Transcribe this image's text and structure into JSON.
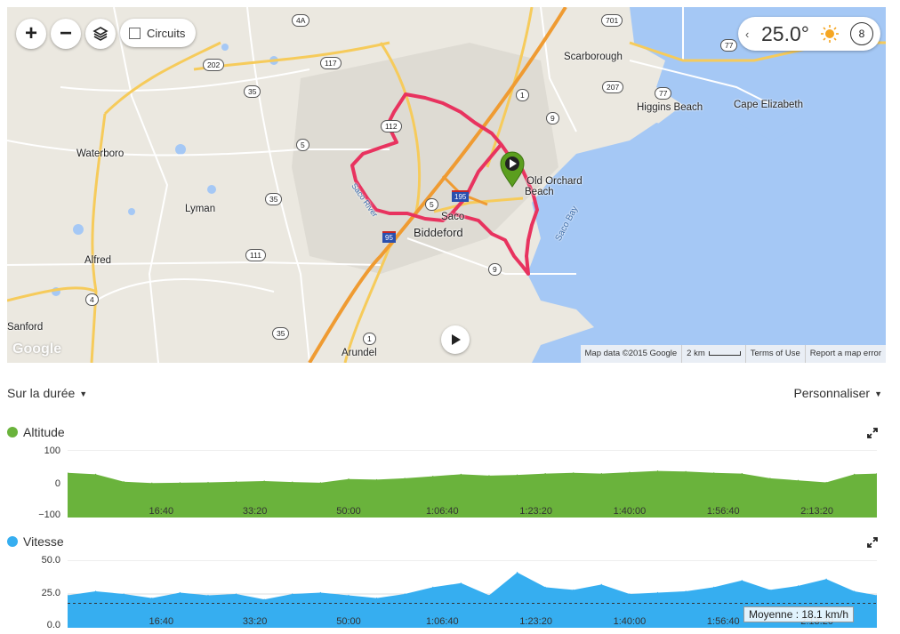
{
  "map": {
    "controls": {
      "zoom_in": "+",
      "zoom_out": "−",
      "circuits_label": "Circuits"
    },
    "weather": {
      "temperature": "25.0°",
      "wind": "8",
      "icon": "sun-icon"
    },
    "labels": {
      "scarborough": "Scarborough",
      "higgins_beach": "Higgins Beach",
      "cape_elizabeth": "Cape Elizabeth",
      "waterboro": "Waterboro",
      "lyman": "Lyman",
      "alfred": "Alfred",
      "sanford": "Sanford",
      "arundel": "Arundel",
      "biddeford": "Biddeford",
      "saco": "Saco",
      "old_orchard_beach_1": "Old Orchard",
      "old_orchard_beach_2": "Beach",
      "saco_bay": "Saco Bay",
      "saco_river": "Saco River"
    },
    "shields": {
      "r4a": "4A",
      "r701": "701",
      "r77a": "77",
      "r77b": "77",
      "r202": "202",
      "r117": "117",
      "r207": "207",
      "r1a": "1",
      "r9a": "9",
      "r35a": "35",
      "r112": "112",
      "r5a": "5",
      "r5b": "5",
      "r35b": "35",
      "r111": "111",
      "r4": "4",
      "r9b": "9",
      "r35c": "35",
      "r1b": "1",
      "i195": "195",
      "i95": "95"
    },
    "attribution": {
      "data": "Map data ©2015 Google",
      "scale": "2 km",
      "terms": "Terms of Use",
      "report": "Report a map error"
    },
    "logo": "Google"
  },
  "toolbar": {
    "duration_label": "Sur la durée",
    "customize_label": "Personnaliser"
  },
  "altitude": {
    "title": "Altitude",
    "color": "#6ab33c",
    "y_ticks": [
      "100",
      "0",
      "−100"
    ],
    "x_ticks": [
      "16:40",
      "33:20",
      "50:00",
      "1:06:40",
      "1:23:20",
      "1:40:00",
      "1:56:40",
      "2:13:20"
    ]
  },
  "speed": {
    "title": "Vitesse",
    "color": "#36aef0",
    "y_ticks": [
      "50.0",
      "25.0",
      "0.0"
    ],
    "x_ticks": [
      "16:40",
      "33:20",
      "50:00",
      "1:06:40",
      "1:23:20",
      "1:40:00",
      "1:56:40",
      "2:13:20"
    ],
    "average_label": "Moyenne : 18.1 km/h"
  },
  "chart_data": [
    {
      "type": "area",
      "title": "Altitude",
      "ylim": [
        -100,
        100
      ],
      "x_unit": "seconds",
      "x_max": 8640,
      "x": [
        0,
        300,
        600,
        900,
        1200,
        1500,
        1800,
        2100,
        2400,
        2700,
        3000,
        3300,
        3600,
        3900,
        4200,
        4500,
        4800,
        5100,
        5400,
        5700,
        6000,
        6300,
        6600,
        6900,
        7200,
        7500,
        7800,
        8100,
        8400,
        8640
      ],
      "values": [
        32,
        28,
        6,
        2,
        3,
        4,
        6,
        8,
        5,
        3,
        14,
        12,
        16,
        22,
        28,
        24,
        26,
        30,
        32,
        30,
        34,
        38,
        36,
        32,
        30,
        16,
        10,
        4,
        28,
        30
      ]
    },
    {
      "type": "area",
      "title": "Vitesse",
      "ylim": [
        0,
        50
      ],
      "x_unit": "seconds",
      "x_max": 8640,
      "average": 18.1,
      "x": [
        0,
        300,
        600,
        900,
        1200,
        1500,
        1800,
        2100,
        2400,
        2700,
        3000,
        3300,
        3600,
        3900,
        4200,
        4500,
        4800,
        5100,
        5400,
        5700,
        6000,
        6300,
        6600,
        6900,
        7200,
        7500,
        7800,
        8100,
        8400,
        8640
      ],
      "values": [
        24,
        27,
        25,
        22,
        26,
        24,
        25,
        21,
        25,
        26,
        24,
        22,
        25,
        30,
        33,
        24,
        41,
        30,
        28,
        32,
        25,
        26,
        27,
        30,
        35,
        28,
        31,
        36,
        27,
        24
      ]
    }
  ]
}
